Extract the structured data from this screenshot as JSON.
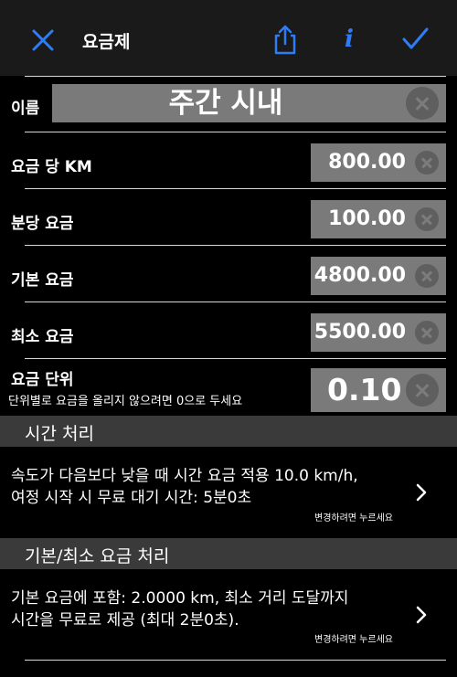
{
  "navbar": {
    "title": "요금제",
    "tint": "#2f7df6",
    "close_icon": "close-icon",
    "share_icon": "share-icon",
    "info_icon": "info-icon",
    "info_glyph": "i",
    "done_icon": "checkmark-icon"
  },
  "form": {
    "name_label": "이름",
    "name_value": "주간 시내",
    "per_km_label": "요금 당 KM",
    "per_km_value": "800.00",
    "per_min_label": "분당 요금",
    "per_min_value": "100.00",
    "base_label": "기본 요금",
    "base_value": "4800.00",
    "min_label": "최소 요금",
    "min_value": "5500.00",
    "unit_label": "요금 단위",
    "unit_hint": "단위별로 요금을 올리지 않으려면 0으로 두세요",
    "unit_value": "0.10"
  },
  "time_section": {
    "header": "시간 처리",
    "line1": "속도가 다음보다 낮을 때 시간 요금 적용 10.0 km/h,",
    "line2": "여정 시작 시 무료 대기 시간: 5분0초",
    "hint": "변경하려면 누르세요"
  },
  "base_section": {
    "header": "기본/최소 요금 처리",
    "line1": "기본 요금에 포함: 2.0000 km, 최소 거리 도달까지",
    "line2": "시간을 무료로 제공 (최대 2분0초).",
    "hint": "변경하려면 누르세요"
  }
}
